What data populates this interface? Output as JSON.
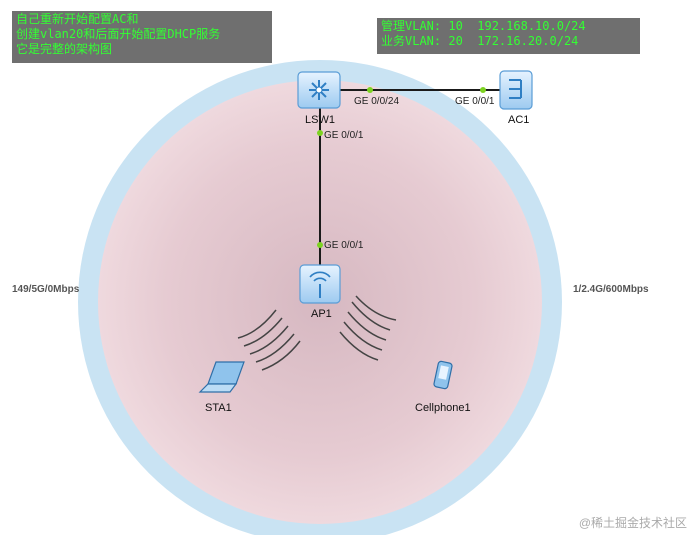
{
  "notes": {
    "left": [
      "自己重新开始配置AC和",
      "创建vlan20和后面开始配置DHCP服务",
      "它是完整的架构图"
    ],
    "right": [
      "管理VLAN: 10  192.168.10.0/24",
      "业务VLAN: 20  172.16.20.0/24"
    ]
  },
  "devices": {
    "lsw1": "LSW1",
    "ac1": "AC1",
    "ap1": "AP1",
    "sta1": "STA1",
    "cellphone1": "Cellphone1"
  },
  "ports": {
    "lsw1_to_ac1": "GE 0/0/24",
    "ac1_to_lsw1": "GE 0/0/1",
    "lsw1_to_ap1": "GE 0/0/1",
    "ap1_to_lsw1": "GE 0/0/1"
  },
  "rates": {
    "left": "149/5G/0Mbps",
    "right": "1/2.4G/600Mbps"
  },
  "watermark": "@稀土掘金技术社区",
  "colors": {
    "note_bg": "#6f6f6f",
    "note_text": "#33ff33",
    "outer_ring": "#c9e3f3",
    "inner_fill": "#e8cdd4",
    "link_dot": "#7dd321",
    "device_blue": "#3a8fd6"
  }
}
